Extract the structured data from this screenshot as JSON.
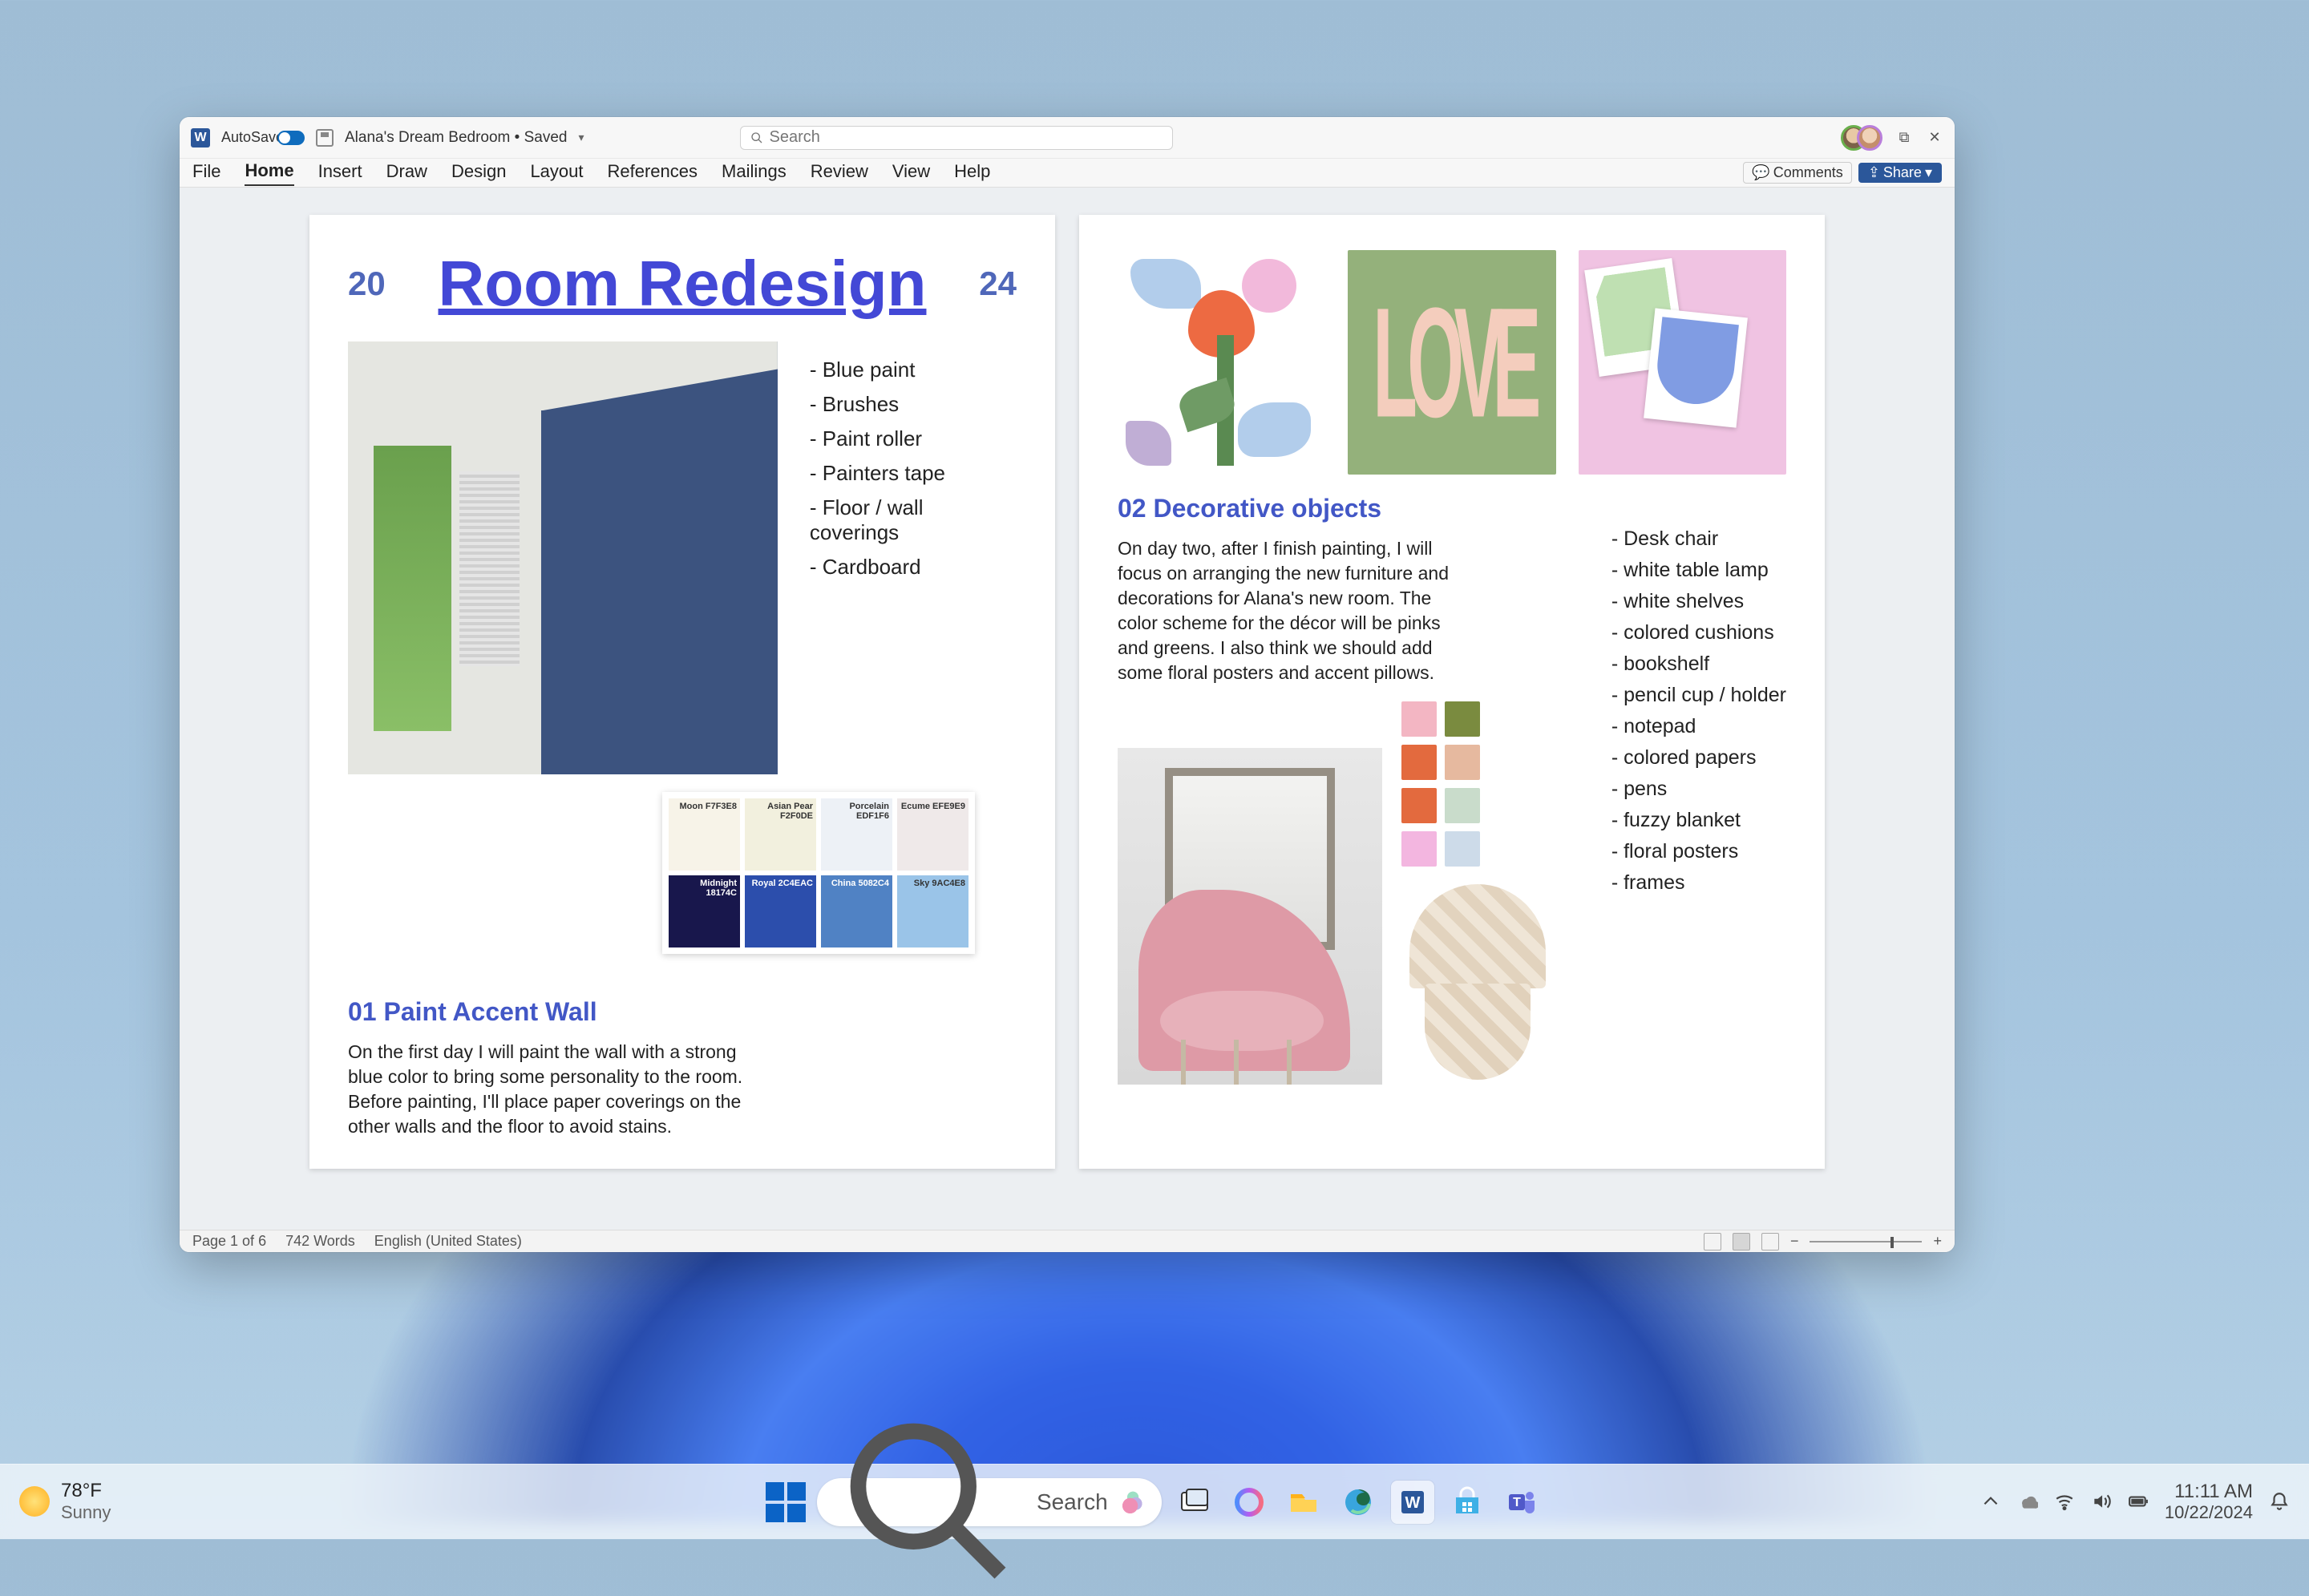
{
  "titlebar": {
    "autosave": "AutoSave",
    "doc_title": "Alana's Dream Bedroom • Saved",
    "search_placeholder": "Search",
    "restore": "⧉",
    "close": "✕"
  },
  "ribbon": {
    "tabs": [
      "File",
      "Home",
      "Insert",
      "Draw",
      "Design",
      "Layout",
      "References",
      "Mailings",
      "Review",
      "View",
      "Help"
    ],
    "active_index": 1,
    "comments": "Comments",
    "share": "Share"
  },
  "page1": {
    "year_left": "20",
    "year_right": "24",
    "title": "Room Redesign",
    "materials": [
      "Blue paint",
      "Brushes",
      "Paint roller",
      "Painters tape",
      "Floor / wall coverings",
      "Cardboard"
    ],
    "swatches": [
      {
        "name": "Moon F7F3E8",
        "bg": "#f7f3e8"
      },
      {
        "name": "Asian Pear F2F0DE",
        "bg": "#f2f0de"
      },
      {
        "name": "Porcelain EDF1F6",
        "bg": "#edf1f6"
      },
      {
        "name": "Ecume EFE9E9",
        "bg": "#efe9e9"
      },
      {
        "name": "Midnight 18174C",
        "bg": "#18174c",
        "dark": true
      },
      {
        "name": "Royal 2C4EAC",
        "bg": "#2c4eac",
        "dark": true
      },
      {
        "name": "China 5082C4",
        "bg": "#5082c4",
        "dark": true
      },
      {
        "name": "Sky 9AC4E8",
        "bg": "#9ac4e8"
      }
    ],
    "h2": "01 Paint Accent Wall",
    "para": "On the first day I will paint the wall with a strong blue color to bring some personality to the room. Before painting, I'll place paper coverings on the other walls and the floor to avoid stains."
  },
  "page2": {
    "love_text": "LOVE",
    "h2": "02 Decorative objects",
    "para": "On day two, after I finish painting, I will focus on arranging the new furniture and decorations for Alana's new room. The color scheme for the décor will be pinks and greens. I also think we should add some floral posters and accent pillows.",
    "palette": [
      "#f3b6c3",
      "#7a8b3f",
      "#e36a3e",
      "#e6b99f",
      "#e36a3e",
      "#c9dccb",
      "#f3b6e0",
      "#cddbe9"
    ],
    "objects": [
      "Desk chair",
      "white table lamp",
      "white shelves",
      "colored cushions",
      "bookshelf",
      "pencil cup / holder",
      "notepad",
      "colored papers",
      "pens",
      "fuzzy blanket",
      "floral posters",
      "frames"
    ]
  },
  "statusbar": {
    "page": "Page 1 of 6",
    "words": "742 Words",
    "lang": "English (United States)",
    "zoom_minus": "−",
    "zoom_plus": "+"
  },
  "taskbar": {
    "temp": "78°F",
    "cond": "Sunny",
    "search_placeholder": "Search",
    "time": "11:11 AM",
    "date": "10/22/2024"
  }
}
